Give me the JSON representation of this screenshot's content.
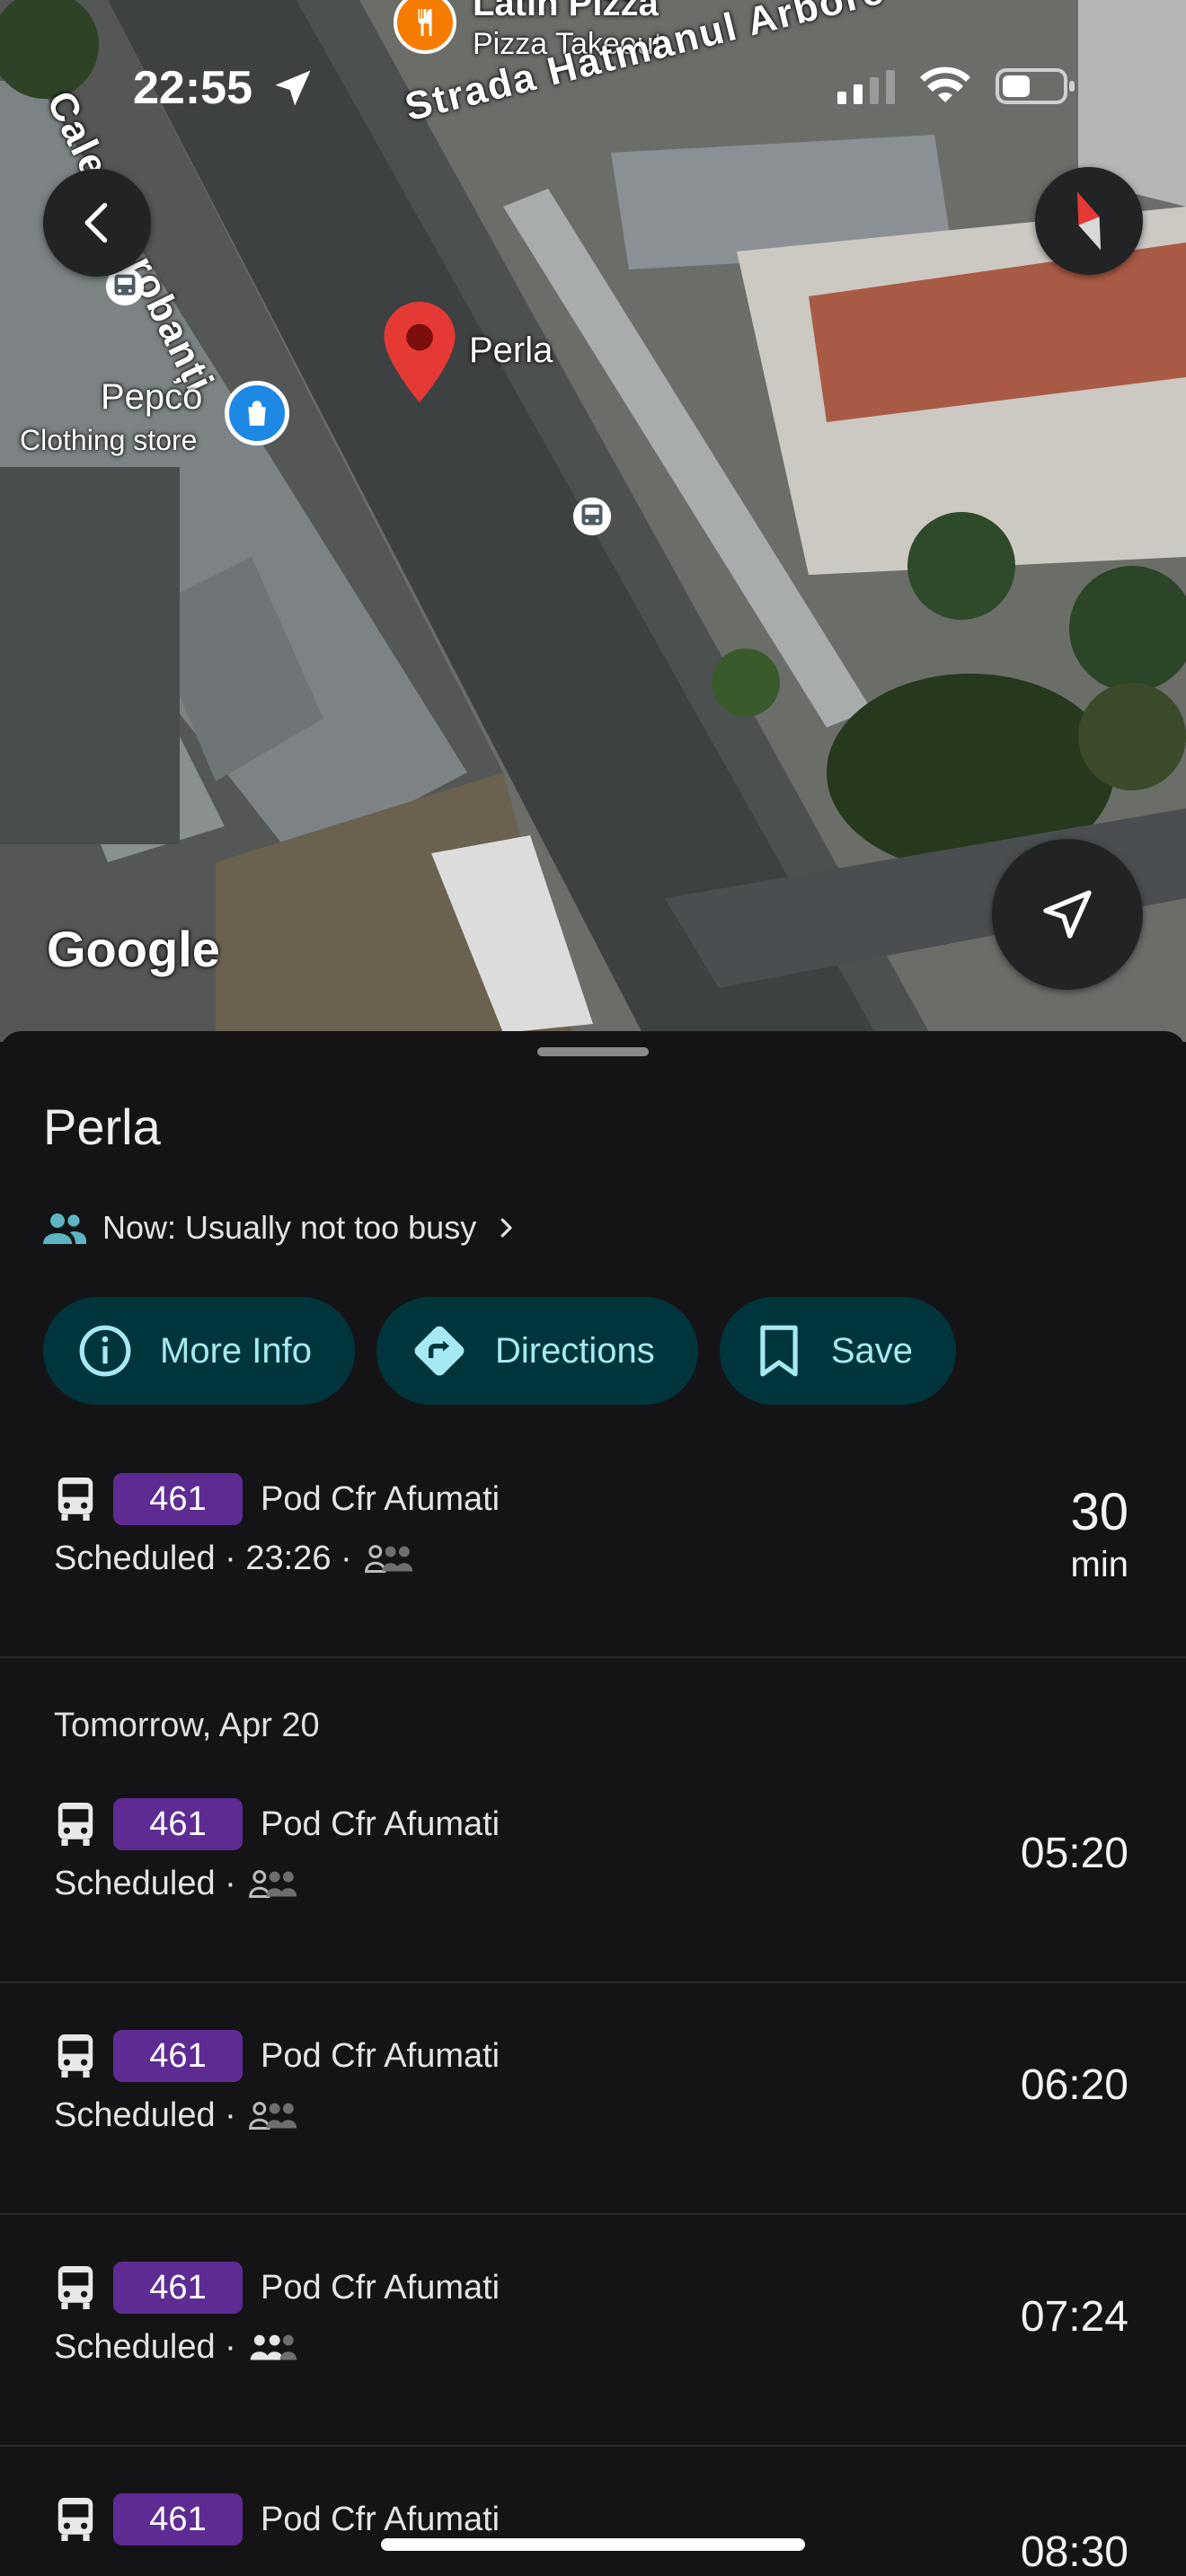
{
  "status_bar": {
    "time": "22:55"
  },
  "map": {
    "poi_top": {
      "name": "Latin Pizza",
      "category": "Pizza Takeout"
    },
    "street_diagonal": "Strada Hatmanul Arbore",
    "street_vertical": "Calea Dorobanți",
    "selected_pin": {
      "name": "Perla"
    },
    "poi_store": {
      "name": "Pepco",
      "category": "Clothing store"
    },
    "attribution": "Google"
  },
  "place": {
    "title": "Perla",
    "busyness": "Now: Usually not too busy"
  },
  "actions": [
    {
      "label": "More Info",
      "icon": "info-icon"
    },
    {
      "label": "Directions",
      "icon": "directions-icon"
    },
    {
      "label": "Save",
      "icon": "bookmark-icon"
    }
  ],
  "next_departure": {
    "route": "461",
    "destination": "Pod Cfr Afumati",
    "status": "Scheduled · 23:26 ·",
    "eta_value": "30",
    "eta_unit": "min"
  },
  "day_header": "Tomorrow, Apr 20",
  "departures": [
    {
      "route": "461",
      "destination": "Pod Cfr Afumati",
      "status": "Scheduled ·",
      "time": "05:20"
    },
    {
      "route": "461",
      "destination": "Pod Cfr Afumati",
      "status": "Scheduled ·",
      "time": "06:20"
    },
    {
      "route": "461",
      "destination": "Pod Cfr Afumati",
      "status": "Scheduled ·",
      "time": "07:24"
    },
    {
      "route": "461",
      "destination": "Pod Cfr Afumati",
      "status": "",
      "time": "08:30"
    }
  ],
  "colors": {
    "sheet_bg": "#141416",
    "chip_bg": "#00363b",
    "chip_text": "#a6e9f3",
    "route_badge": "#5e2b93",
    "pin_red": "#e53935",
    "store_pin": "#1e88e5",
    "food_pin": "#f57c00"
  }
}
